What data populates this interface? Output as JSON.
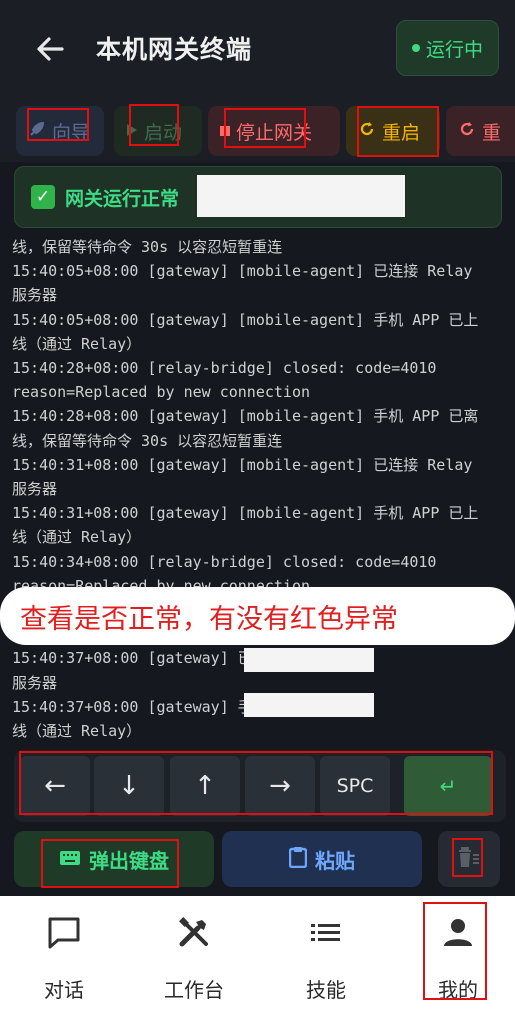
{
  "header": {
    "title": "本机网关终端",
    "status": "运行中"
  },
  "toolbar": {
    "guide": "向导",
    "start": "启动",
    "stop": "停止网关",
    "restart": "重启",
    "restart_clipped": "重"
  },
  "banner": {
    "check": "✓",
    "text": "网关运行正常"
  },
  "log": [
    "线，保留等待命令 30s 以容忍短暂重连",
    "15:40:05+08:00 [gateway] [mobile-agent] 已连接 Relay",
    "服务器",
    "15:40:05+08:00 [gateway] [mobile-agent] 手机 APP 已上",
    "线（通过 Relay）",
    "15:40:28+08:00 [relay-bridge] closed: code=4010",
    "reason=Replaced by new connection",
    "15:40:28+08:00 [gateway] [mobile-agent] 手机 APP 已离",
    "线，保留等待命令 30s 以容忍短暂重连",
    "15:40:31+08:00 [gateway] [mobile-agent] 已连接 Relay",
    "服务器",
    "15:40:31+08:00 [gateway] [mobile-agent] 手机 APP 已上",
    "线（通过 Relay）",
    "15:40:34+08:00 [relay-bridge] closed: code=4010",
    "reason=Replaced by new connection",
    "",
    "",
    "15:40:37+08:00 [gateway]                  已连接 Relay",
    "服务器",
    "15:40:37+08:00 [gateway]                  手机 APP 已上",
    "线（通过 Relay）"
  ],
  "annotation": "查看是否正常，有没有红色异常",
  "keys": {
    "left": "←",
    "down": "↓",
    "up": "↑",
    "right": "→",
    "space": "SPC",
    "enter": "↵"
  },
  "actions": {
    "keyboard": "弹出键盘",
    "paste": "粘贴"
  },
  "nav": {
    "chat": "对话",
    "workbench": "工作台",
    "skills": "技能",
    "mine": "我的"
  },
  "colors": {
    "accent_green": "#3ddc84",
    "stop_red": "#ff6b6b",
    "restart_amber": "#f4b400",
    "paste_blue": "#6ea8fe",
    "annotation_red": "#e01010"
  }
}
